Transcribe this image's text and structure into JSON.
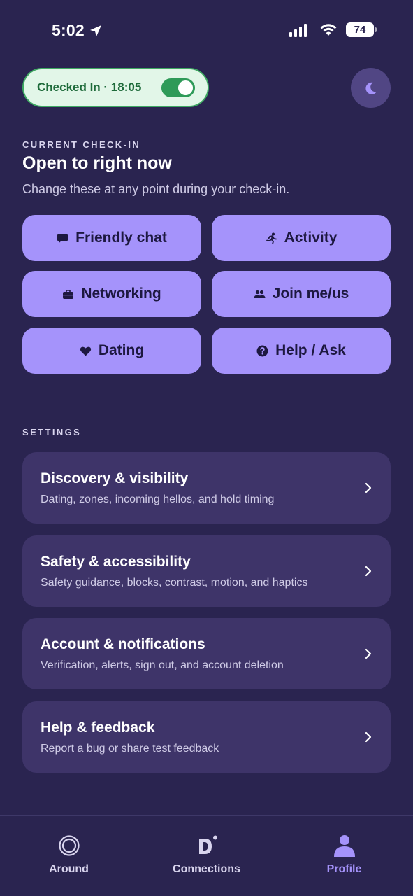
{
  "status_bar": {
    "time": "5:02",
    "battery": "74"
  },
  "checkin": {
    "pill_label": "Checked In · 18:05",
    "toggle_on": true
  },
  "current": {
    "section_label": "CURRENT CHECK-IN",
    "title": "Open to right now",
    "subtitle": "Change these at any point during your check-in."
  },
  "intents": [
    {
      "label": "Friendly chat",
      "icon": "chat-bubble-icon"
    },
    {
      "label": "Activity",
      "icon": "running-person-icon"
    },
    {
      "label": "Networking",
      "icon": "briefcase-icon"
    },
    {
      "label": "Join me/us",
      "icon": "people-icon"
    },
    {
      "label": "Dating",
      "icon": "heart-icon"
    },
    {
      "label": "Help / Ask",
      "icon": "question-icon"
    }
  ],
  "settings": {
    "section_label": "SETTINGS",
    "items": [
      {
        "title": "Discovery & visibility",
        "description": "Dating, zones, incoming hellos, and hold timing"
      },
      {
        "title": "Safety & accessibility",
        "description": "Safety guidance, blocks, contrast, motion, and haptics"
      },
      {
        "title": "Account & notifications",
        "description": "Verification, alerts, sign out, and account deletion"
      },
      {
        "title": "Help & feedback",
        "description": "Report a bug or share test feedback"
      }
    ]
  },
  "tabs": [
    {
      "label": "Around",
      "icon": "target-circle-icon",
      "active": false
    },
    {
      "label": "Connections",
      "icon": "d-logo-icon",
      "active": false
    },
    {
      "label": "Profile",
      "icon": "person-icon",
      "active": true
    }
  ],
  "colors": {
    "background": "#2a2450",
    "chip": "#a593fb",
    "card": "#3e3469",
    "checkin_bg": "#e2f6e8",
    "checkin_accent": "#2e9a58",
    "active_tab": "#a593fb"
  }
}
